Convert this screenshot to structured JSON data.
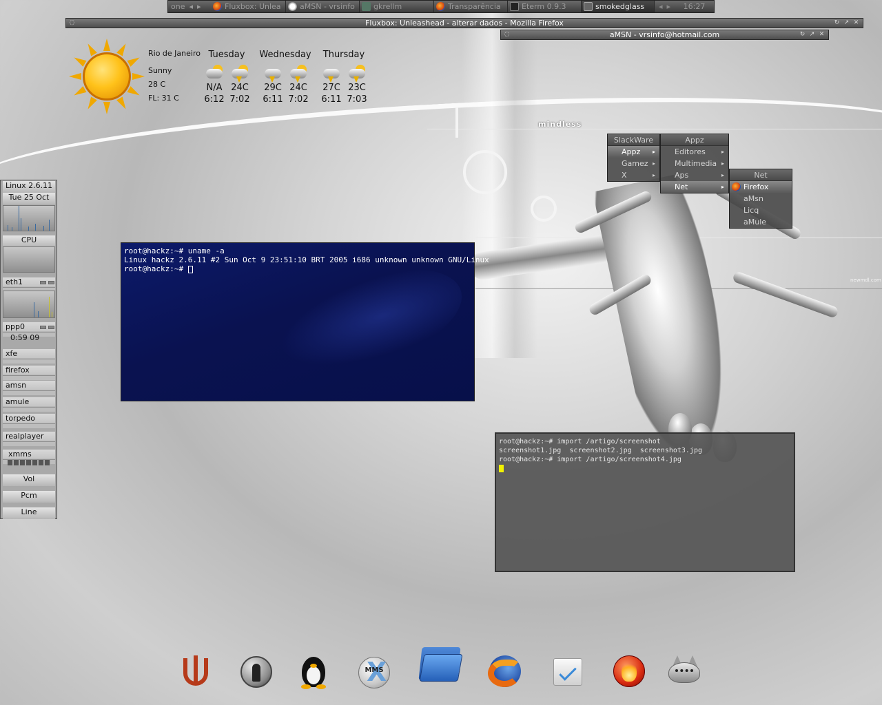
{
  "toolbar": {
    "workspace": "one",
    "tasks": [
      {
        "label": "Fluxbox: Unlea",
        "icon": "firefox-icon",
        "focused": false
      },
      {
        "label": "aMSN - vrsinfo",
        "icon": "amsn-icon",
        "focused": false
      },
      {
        "label": "gkrellm",
        "icon": "gkrellm-icon",
        "focused": false
      },
      {
        "label": "Transparência",
        "icon": "firefox-icon",
        "focused": false
      },
      {
        "label": "Eterm 0.9.3",
        "icon": "eterm-icon",
        "focused": false
      },
      {
        "label": "smokedglass",
        "icon": "terminal-icon",
        "focused": true
      }
    ],
    "clock": "16:27"
  },
  "windows": {
    "firefox_title": "Fluxbox: Unleashead - alterar dados - Mozilla Firefox",
    "amsn_title": "aMSN - vrsinfo@hotmail.com"
  },
  "weather": {
    "city": "Rio de Janeiro",
    "condition": "Sunny",
    "temp": "28 C",
    "feels_like": "FL: 31 C",
    "days": [
      {
        "name": "Tuesday",
        "lo": "N/A",
        "hi": "24C",
        "rise": "6:12",
        "set": "7:02"
      },
      {
        "name": "Wednesday",
        "lo": "29C",
        "hi": "24C",
        "rise": "6:11",
        "set": "7:02"
      },
      {
        "name": "Thursday",
        "lo": "27C",
        "hi": "23C",
        "rise": "6:11",
        "set": "7:03"
      }
    ]
  },
  "gkrellm": {
    "kernel": "Linux 2.6.11",
    "date": "Tue 25 Oct",
    "cpu_label": "CPU",
    "net_label": "eth1",
    "ppp_label": "ppp0",
    "ppp_time": "0:59 09",
    "launchers": [
      "xfe",
      "firefox",
      "amsn",
      "amule",
      "torpedo",
      "realplayer"
    ],
    "xmms_label": "xmms",
    "mixer": [
      "Vol",
      "Pcm",
      "Line"
    ]
  },
  "menu": {
    "root_title": "SlackWare",
    "root_items": [
      "Appz",
      "Gamez",
      "X"
    ],
    "appz_title": "Appz",
    "appz_items": [
      "Editores",
      "Multimedia",
      "Aps",
      "Net"
    ],
    "net_title": "Net",
    "net_items": [
      "Firefox",
      "aMsn",
      "Licq",
      "aMule"
    ]
  },
  "terminal1": {
    "lines": [
      "root@hackz:~# uname -a",
      "Linux hackz 2.6.11 #2 Sun Oct 9 23:51:10 BRT 2005 i686 unknown unknown GNU/Linux",
      "root@hackz:~# "
    ]
  },
  "terminal2": {
    "lines": [
      "root@hackz:~# import /artigo/screenshot",
      "screenshot1.jpg  screenshot2.jpg  screenshot3.jpg",
      "root@hackz:~# import /artigo/screenshot4.jpg"
    ]
  },
  "wallpaper": {
    "logo_text": "mindless",
    "credit": "newmdl.com"
  },
  "dock": {
    "icons": [
      "quake3-icon",
      "counter-strike-icon",
      "tux-icon",
      "mms-icon",
      "folder-icon",
      "firefox-icon",
      "mail-icon",
      "fire-icon",
      "gimp-icon"
    ]
  },
  "colors": {
    "term1_bg": "#0a1250",
    "term2_bg": "#555555",
    "cursor": "#f2f200"
  }
}
